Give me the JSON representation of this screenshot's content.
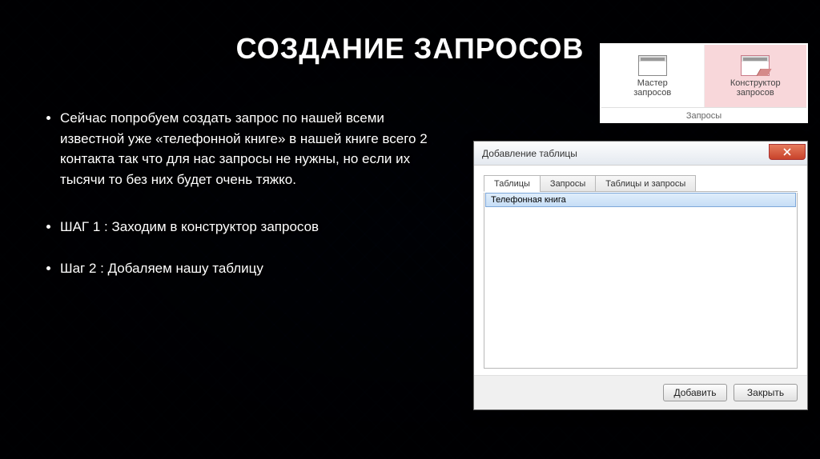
{
  "title": "СОЗДАНИЕ ЗАПРОСОВ",
  "bullets": [
    "Сейчас попробуем создать запрос по нашей всеми известной уже «телефонной книге» в нашей книге всего 2 контакта так что для нас запросы не нужны, но если их тысячи то без них будет очень тяжко.",
    "ШАГ 1 : Заходим в конструктор запросов",
    "Шаг 2 : Добаляем нашу таблицу"
  ],
  "ribbon": {
    "btn1_line1": "Мастер",
    "btn1_line2": "запросов",
    "btn2_line1": "Конструктор",
    "btn2_line2": "запросов",
    "group": "Запросы"
  },
  "dialog": {
    "title": "Добавление таблицы",
    "tabs": [
      "Таблицы",
      "Запросы",
      "Таблицы и запросы"
    ],
    "list_item": "Телефонная книга",
    "btn_add": "Добавить",
    "btn_close": "Закрыть"
  }
}
